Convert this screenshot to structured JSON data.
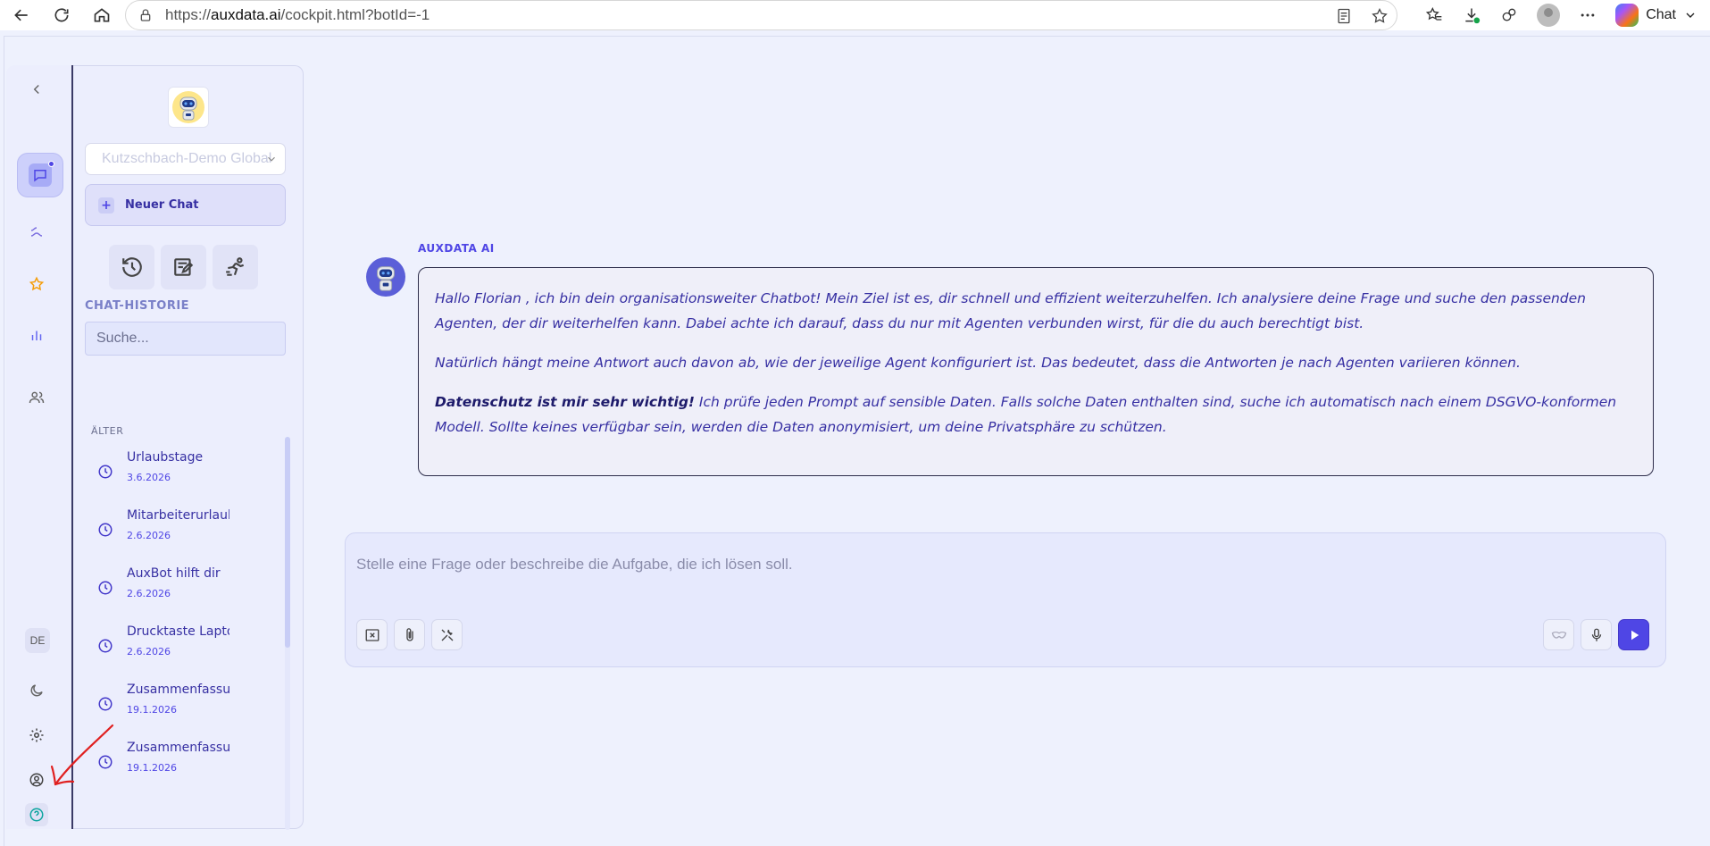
{
  "browser": {
    "url_prefix": "https://",
    "url_host": "auxdata.ai",
    "url_path": "/cockpit.html?botId=-1",
    "chat_label": "Chat"
  },
  "sidebar": {
    "org_select_value": "Kutzschbach-Demo Global",
    "new_chat_label": "Neuer Chat",
    "history_title": "CHAT-HISTORIE",
    "search_placeholder": "Suche...",
    "group_label": "ÄLTER",
    "history": [
      {
        "title": "Urlaubstage",
        "date": "3.6.2026"
      },
      {
        "title": "Mitarbeiterurlaub",
        "date": "2.6.2026"
      },
      {
        "title": "AuxBot hilft dir",
        "date": "2.6.2026"
      },
      {
        "title": "Drucktaste Laptop",
        "date": "2.6.2026"
      },
      {
        "title": "Zusammenfassung",
        "date": "19.1.2026"
      },
      {
        "title": "Zusammenfassung",
        "date": "19.1.2026"
      }
    ]
  },
  "rail": {
    "language": "DE"
  },
  "message": {
    "author": "AUXDATA AI",
    "p1": "Hallo Florian , ich bin dein organisationsweiter Chatbot! Mein Ziel ist es, dir schnell und effizient weiterzuhelfen. Ich analysiere deine Frage und suche den passenden Agenten, der dir weiterhelfen kann. Dabei achte ich darauf, dass du nur mit Agenten verbunden wirst, für die du auch berechtigt bist.",
    "p2": "Natürlich hängt meine Antwort auch davon ab, wie der jeweilige Agent konfiguriert ist. Das bedeutet, dass die Antworten je nach Agenten variieren können.",
    "p3_bold": "Datenschutz ist mir sehr wichtig!",
    "p3_rest": " Ich prüfe jeden Prompt auf sensible Daten. Falls solche Daten enthalten sind, suche ich automatisch nach einem DSGVO-konformen Modell. Sollte keines verfügbar sein, werden die Daten anonymisiert, um deine Privatsphäre zu schützen."
  },
  "composer": {
    "placeholder": "Stelle eine Frage oder beschreibe die Aufgabe, die ich lösen soll."
  },
  "colors": {
    "accent": "#4f46e5",
    "background": "#eef1fd",
    "annotation": "#e02020"
  }
}
